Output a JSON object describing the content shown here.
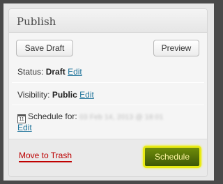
{
  "panel": {
    "title": "Publish"
  },
  "buttons": {
    "save_draft": "Save Draft",
    "preview": "Preview",
    "schedule": "Schedule",
    "move_to_trash": "Move to Trash"
  },
  "status": {
    "label": "Status:",
    "value": "Draft",
    "edit": "Edit"
  },
  "visibility": {
    "label": "Visibility:",
    "value": "Public",
    "edit": "Edit"
  },
  "schedule": {
    "label": "Schedule for:",
    "value_obscured": "03 Feb 14, 2013 @ 18:01",
    "edit": "Edit",
    "calendar_day": "11"
  },
  "colors": {
    "link": "#21759b",
    "trash": "#bc0000",
    "schedule_button": "#4f6e08",
    "highlight": "#e8ea14"
  }
}
